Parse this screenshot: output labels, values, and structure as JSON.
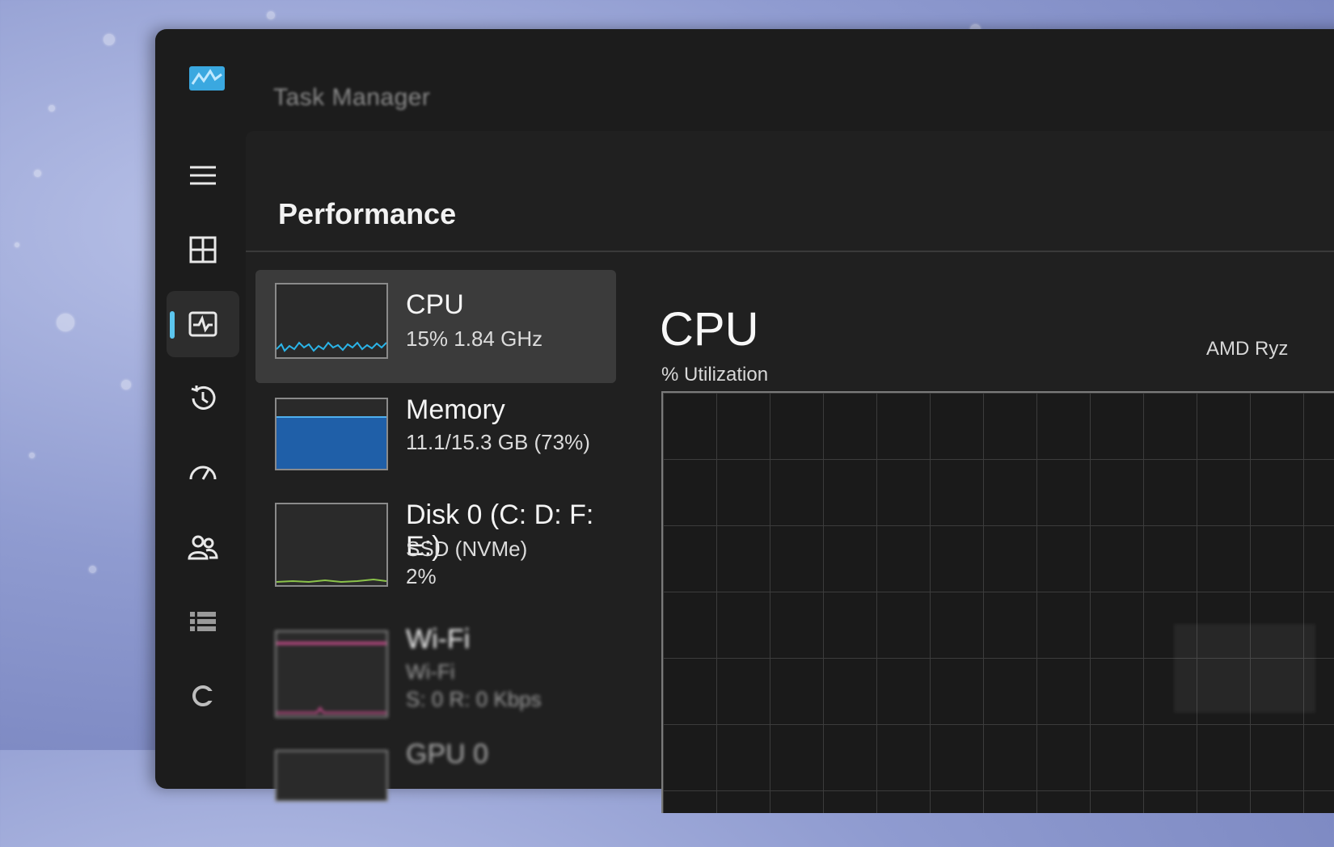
{
  "window": {
    "title": "Task Manager"
  },
  "colors": {
    "accent": "#5cc6ee",
    "cpu_line": "#2ab4e8",
    "memory_fill": "#1f5fa8",
    "disk_line": "#8bc34a",
    "wifi_line": "#e0509a"
  },
  "nav": {
    "items": [
      {
        "icon": "hamburger-menu-icon"
      },
      {
        "icon": "processes-icon"
      },
      {
        "icon": "performance-icon",
        "active": true
      },
      {
        "icon": "app-history-icon"
      },
      {
        "icon": "startup-apps-icon"
      },
      {
        "icon": "users-icon"
      },
      {
        "icon": "details-icon"
      },
      {
        "icon": "services-icon"
      }
    ]
  },
  "page": {
    "title": "Performance"
  },
  "resources": [
    {
      "name": "CPU",
      "sub1": "15%  1.84 GHz"
    },
    {
      "name": "Memory",
      "sub1": "11.1/15.3 GB (73%)",
      "usage_fraction": 0.73
    },
    {
      "name": "Disk 0 (C: D: F: E:)",
      "sub1": "SSD (NVMe)",
      "sub2": "2%"
    },
    {
      "name": "Wi-Fi",
      "sub1": "Wi-Fi",
      "sub2": "S: 0 R: 0 Kbps"
    },
    {
      "name": "GPU 0"
    }
  ],
  "detail": {
    "title": "CPU",
    "util_label": "% Utilization",
    "model": "AMD Ryz"
  }
}
